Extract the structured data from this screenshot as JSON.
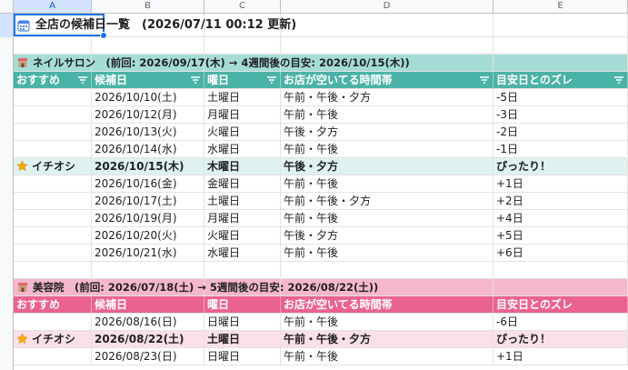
{
  "columns": [
    "A",
    "B",
    "C",
    "D",
    "E"
  ],
  "title": {
    "text": "全店の候補日一覧　(2026/07/11 00:12 更新)",
    "icon": "calendar-icon"
  },
  "nail": {
    "banner": "ネイルサロン　(前回: 2026/09/17(木) → 4週間後の目安: 2026/10/15(木))",
    "headers": [
      "おすすめ",
      "候補日",
      "曜日",
      "お店が空いてる時間帯",
      "目安日とのズレ"
    ],
    "rows": [
      {
        "rec": "",
        "date": "2026/10/10(土)",
        "day": "土曜日",
        "time": "午前・午後・夕方",
        "diff": "-5日"
      },
      {
        "rec": "",
        "date": "2026/10/12(月)",
        "day": "月曜日",
        "time": "午前・午後",
        "diff": "-3日"
      },
      {
        "rec": "",
        "date": "2026/10/13(火)",
        "day": "火曜日",
        "time": "午後・夕方",
        "diff": "-2日"
      },
      {
        "rec": "",
        "date": "2026/10/14(水)",
        "day": "水曜日",
        "time": "午前・午後",
        "diff": "-1日"
      },
      {
        "rec": "イチオシ",
        "date": "2026/10/15(木)",
        "day": "木曜日",
        "time": "午後・夕方",
        "diff": "ぴったり！",
        "top": true
      },
      {
        "rec": "",
        "date": "2026/10/16(金)",
        "day": "金曜日",
        "time": "午前・午後",
        "diff": "+1日"
      },
      {
        "rec": "",
        "date": "2026/10/17(土)",
        "day": "土曜日",
        "time": "午前・午後・夕方",
        "diff": "+2日"
      },
      {
        "rec": "",
        "date": "2026/10/19(月)",
        "day": "月曜日",
        "time": "午前・午後",
        "diff": "+4日"
      },
      {
        "rec": "",
        "date": "2026/10/20(火)",
        "day": "火曜日",
        "time": "午後・夕方",
        "diff": "+5日"
      },
      {
        "rec": "",
        "date": "2026/10/21(水)",
        "day": "水曜日",
        "time": "午前・午後",
        "diff": "+6日"
      }
    ]
  },
  "beauty": {
    "banner": "美容院　(前回: 2026/07/18(土) → 5週間後の目安: 2026/08/22(土))",
    "headers": [
      "おすすめ",
      "候補日",
      "曜日",
      "お店が空いてる時間帯",
      "目安日とのズレ"
    ],
    "rows": [
      {
        "rec": "",
        "date": "2026/08/16(日)",
        "day": "日曜日",
        "time": "午前・午後",
        "diff": "-6日"
      },
      {
        "rec": "イチオシ",
        "date": "2026/08/22(土)",
        "day": "土曜日",
        "time": "午前・午後・夕方",
        "diff": "ぴったり！",
        "top": true
      },
      {
        "rec": "",
        "date": "2026/08/23(日)",
        "day": "日曜日",
        "time": "午前・午後",
        "diff": "+1日"
      }
    ]
  },
  "colors": {
    "nail_header": "#4bb3a6",
    "nail_section": "#a5ddd6",
    "beauty_header": "#ea6292",
    "beauty_section": "#f5b7cc",
    "star": "#f9ab00"
  }
}
